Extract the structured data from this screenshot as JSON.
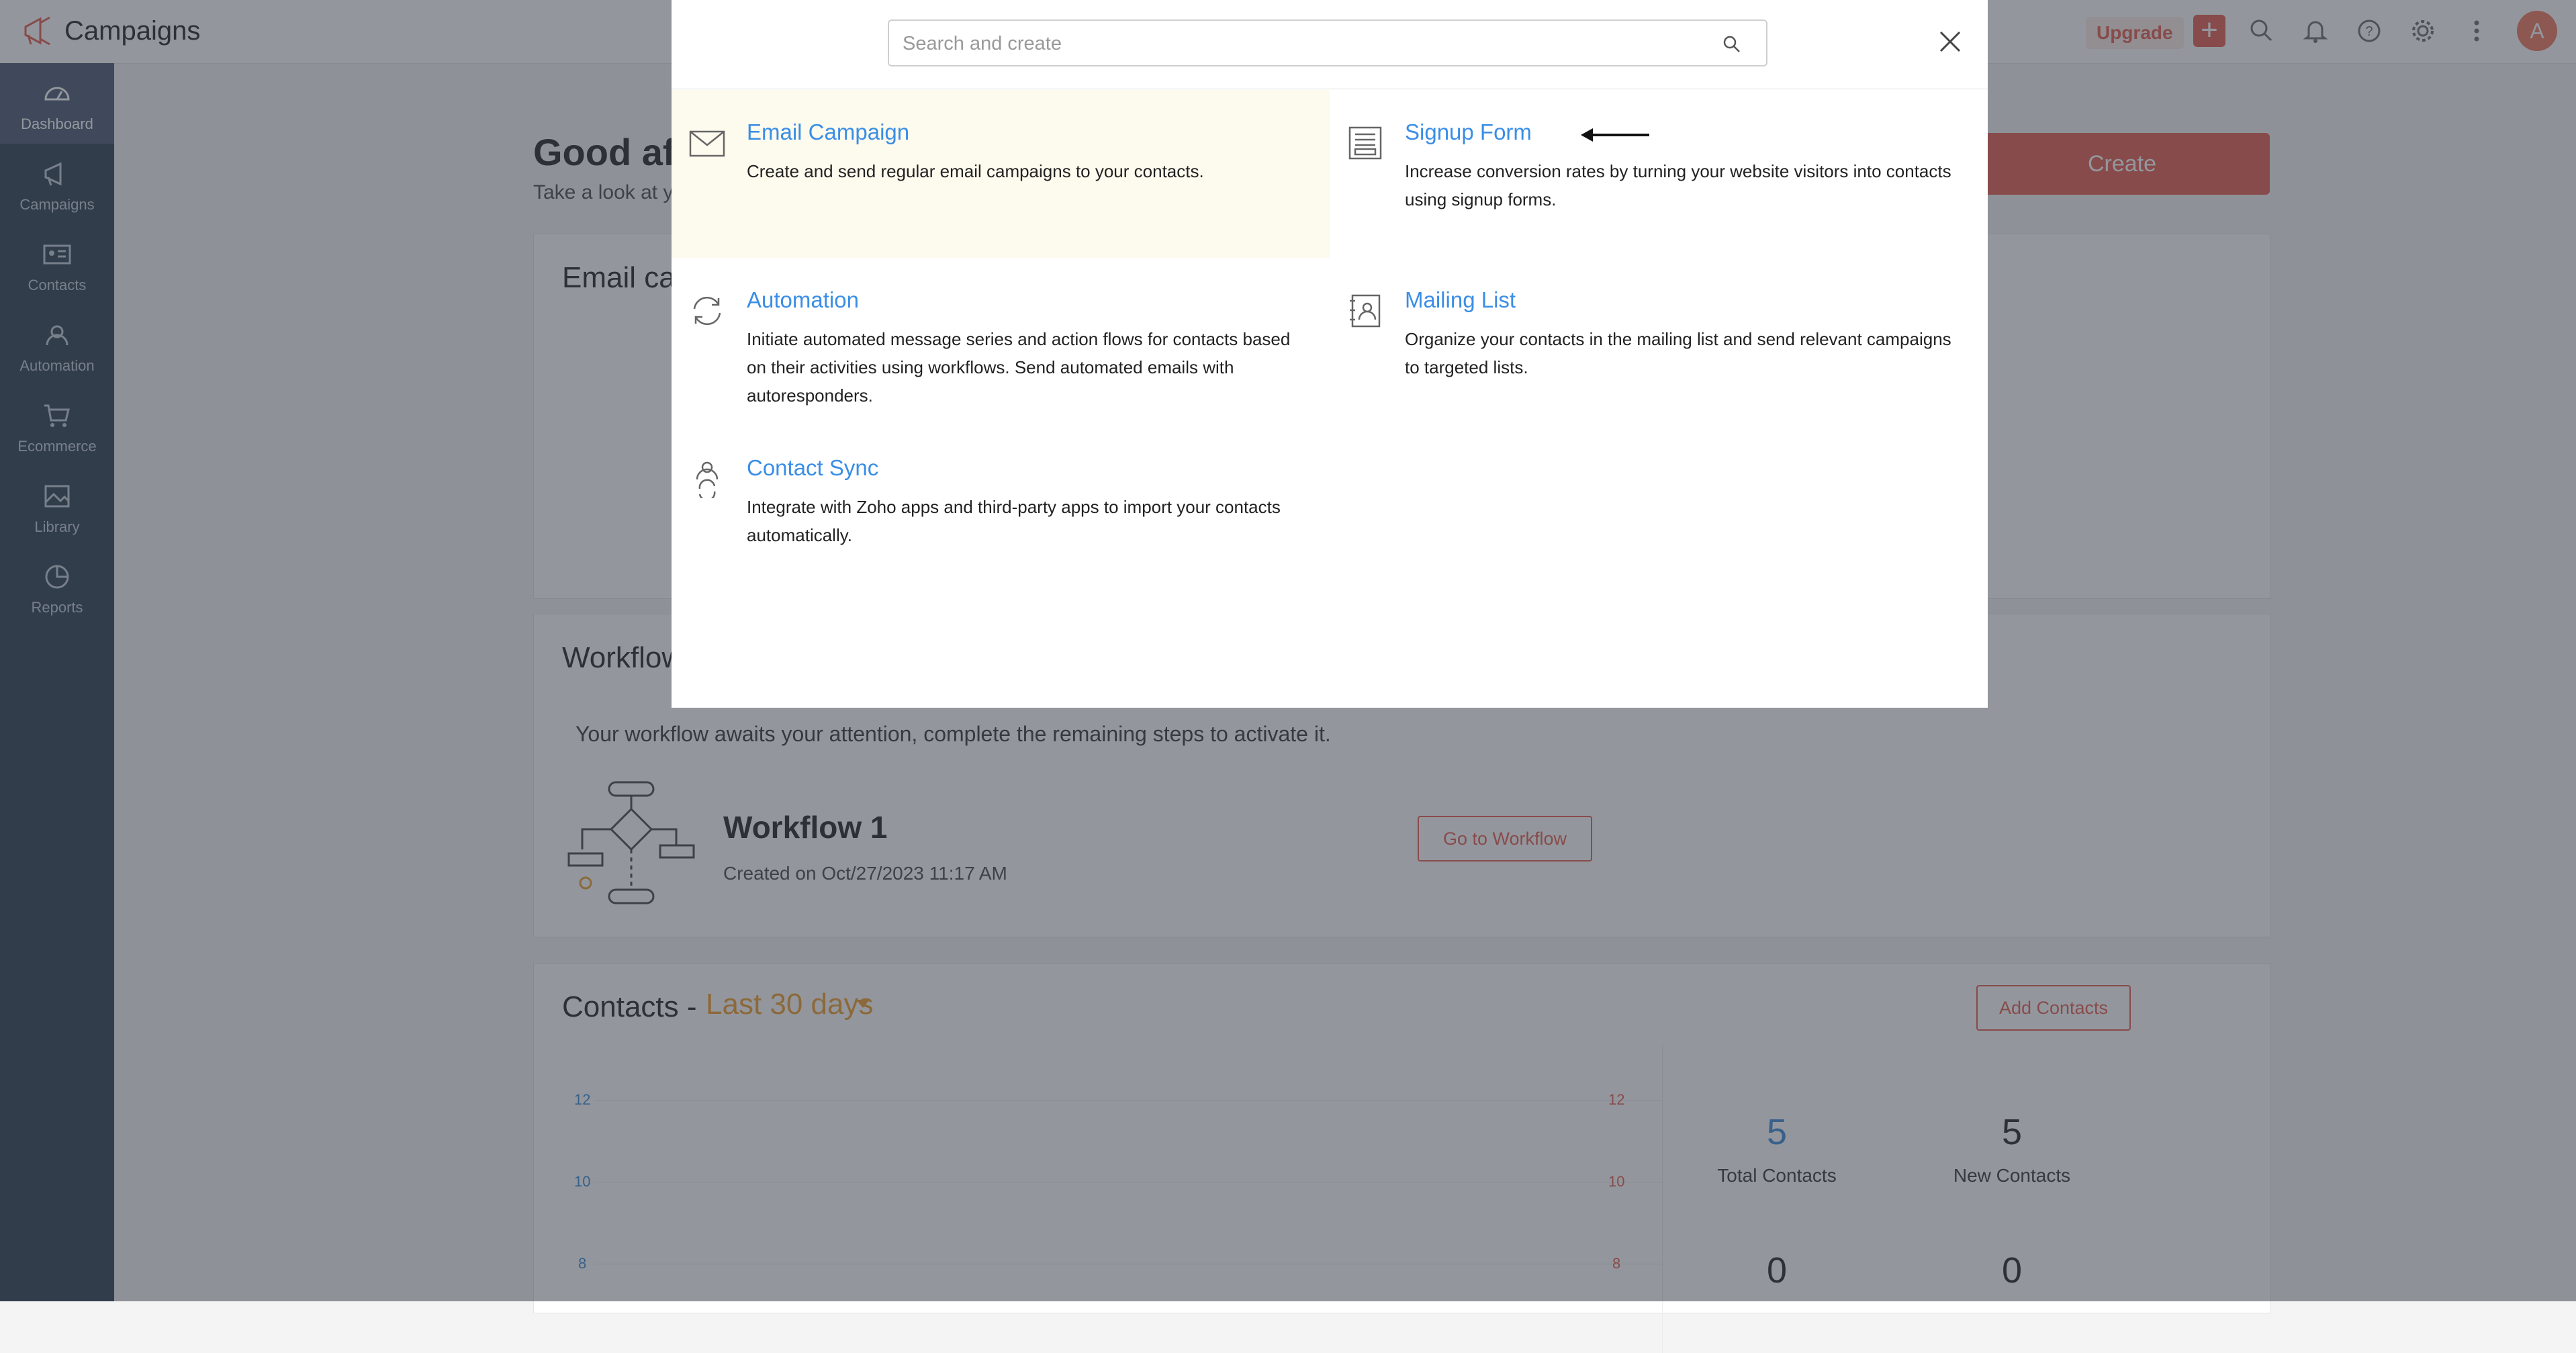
{
  "app": {
    "title": "Campaigns",
    "upgrade_label": "Upgrade",
    "avatar_initial": "A"
  },
  "sidebar": {
    "items": [
      {
        "label": "Dashboard",
        "icon": "dashboard-icon",
        "active": true
      },
      {
        "label": "Campaigns",
        "icon": "megaphone-icon"
      },
      {
        "label": "Contacts",
        "icon": "contact-card-icon"
      },
      {
        "label": "Automation",
        "icon": "automation-icon"
      },
      {
        "label": "Ecommerce",
        "icon": "cart-icon"
      },
      {
        "label": "Library",
        "icon": "library-icon"
      },
      {
        "label": "Reports",
        "icon": "pie-chart-icon"
      }
    ]
  },
  "dashboard": {
    "greeting": "Good aft",
    "subtitle": "Take a look at yo",
    "create_label": "Create",
    "email_card_title": "Email ca",
    "workflow_card_title": "Workflow",
    "workflow_message": "Your workflow awaits your attention, complete the remaining steps to activate it.",
    "workflow_name": "Workflow 1",
    "workflow_created": "Created on Oct/27/2023 11:17 AM",
    "go_to_workflow_label": "Go to Workflow",
    "contacts_title": "Contacts -",
    "contacts_range": "Last 30 days",
    "add_contacts_label": "Add Contacts",
    "axis_left": [
      "12",
      "10",
      "8"
    ],
    "axis_right": [
      "12",
      "10",
      "8"
    ],
    "stats": [
      {
        "value": "5",
        "label": "Total Contacts",
        "color": "#4a90d9"
      },
      {
        "value": "5",
        "label": "New Contacts",
        "color": "#333333"
      },
      {
        "value": "0",
        "label": ""
      },
      {
        "value": "0",
        "label": ""
      }
    ]
  },
  "modal": {
    "search_placeholder": "Search and create",
    "options": [
      {
        "title": "Email Campaign",
        "description": "Create and send regular email campaigns to your contacts.",
        "icon": "envelope-icon",
        "highlighted": true
      },
      {
        "title": "Signup Form",
        "description": "Increase conversion rates by turning your website visitors into contacts using signup forms.",
        "icon": "form-icon"
      },
      {
        "title": "Automation",
        "description": "Initiate automated message series and action flows for contacts based on their activities using workflows. Send automated emails with autoresponders.",
        "icon": "sync-icon"
      },
      {
        "title": "Mailing List",
        "description": "Organize your contacts in the mailing list and send relevant campaigns to targeted lists.",
        "icon": "contact-list-icon"
      },
      {
        "title": "Contact Sync",
        "description": "Integrate with Zoho apps and third-party apps to import your contacts automatically.",
        "icon": "contact-sync-icon"
      }
    ]
  },
  "colors": {
    "accent": "#e8665b",
    "link": "#3a8ee6",
    "sidebar": "#3d4a5c",
    "highlight": "#fdfaee",
    "range": "#f0a23a"
  }
}
